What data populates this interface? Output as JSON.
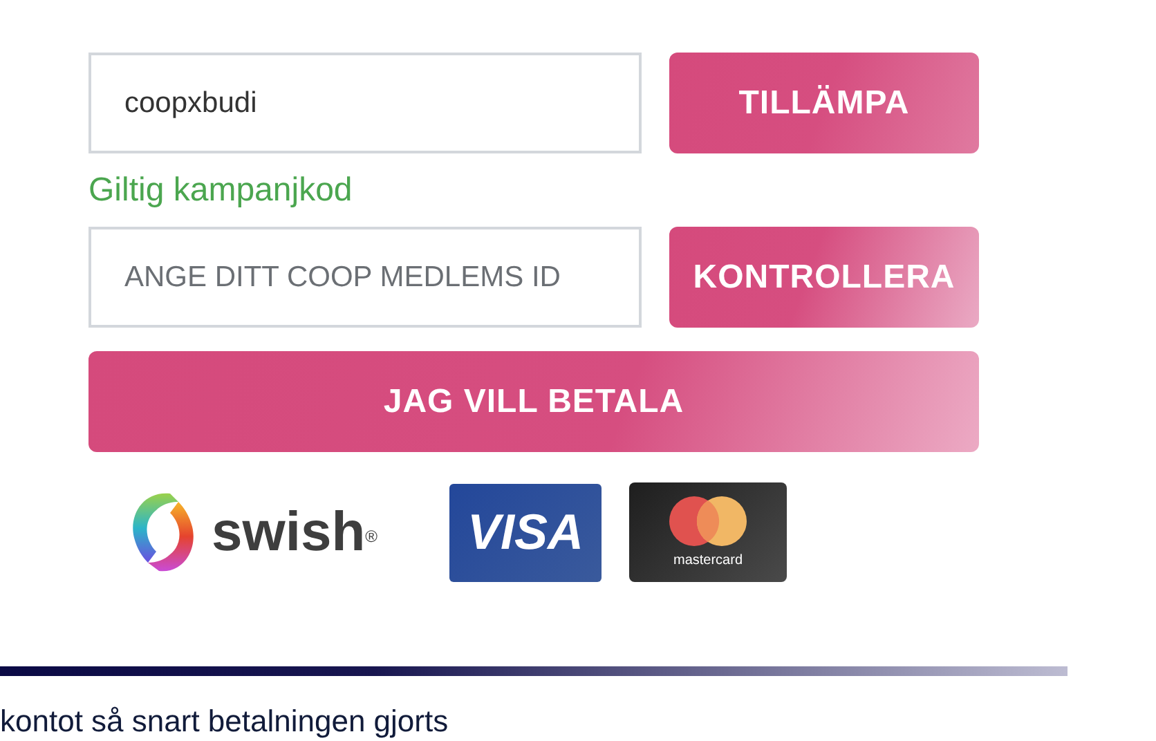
{
  "promo": {
    "value": "coopxbudi",
    "button": "TILLÄMPA",
    "status": "Giltig kampanjkod",
    "valid": true
  },
  "member": {
    "placeholder": "ANGE DITT COOP MEDLEMS ID",
    "button": "KONTROLLERA"
  },
  "pay_button": "JAG VILL BETALA",
  "payment_methods": [
    {
      "kind": "swish",
      "label": "swish",
      "mark": "®"
    },
    {
      "kind": "visa",
      "label": "VISA"
    },
    {
      "kind": "mastercard",
      "label": "mastercard"
    }
  ],
  "footer_text": "kontot så snart betalningen gjorts"
}
